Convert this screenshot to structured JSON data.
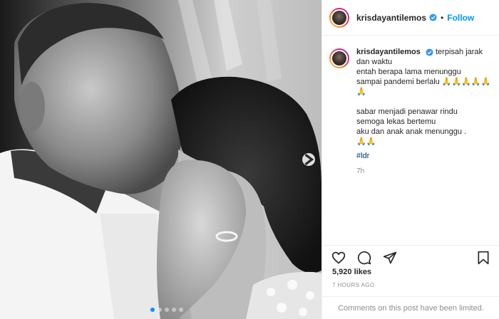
{
  "post": {
    "username": "krisdayantilemos",
    "verified": true,
    "separator": "•",
    "follow_label": "Follow"
  },
  "caption": {
    "username": "krisdayantilemos",
    "lines": [
      "terpisah jarak dan waktu",
      "entah berapa lama menunggu",
      "sampai pandemi berlalu 🙏🙏🙏🙏🙏🙏",
      "",
      "sabar menjadi penawar rindu",
      "semoga lekas bertemu",
      "aku dan anak anak menunggu .",
      "🙏🙏"
    ],
    "hashtag": "#ldr",
    "time": "7h"
  },
  "actions": {
    "like_icon": "heart-icon",
    "comment_icon": "comment-icon",
    "share_icon": "share-icon",
    "save_icon": "bookmark-icon"
  },
  "likes": "5,920 likes",
  "timestamp": "7 HOURS AGO",
  "comments_limited": "Comments on this post have been limited.",
  "carousel": {
    "count": 5,
    "active": 0
  },
  "colors": {
    "accent": "#0095f6",
    "text": "#262626",
    "muted": "#8e8e8e",
    "hashtag": "#00376b"
  }
}
